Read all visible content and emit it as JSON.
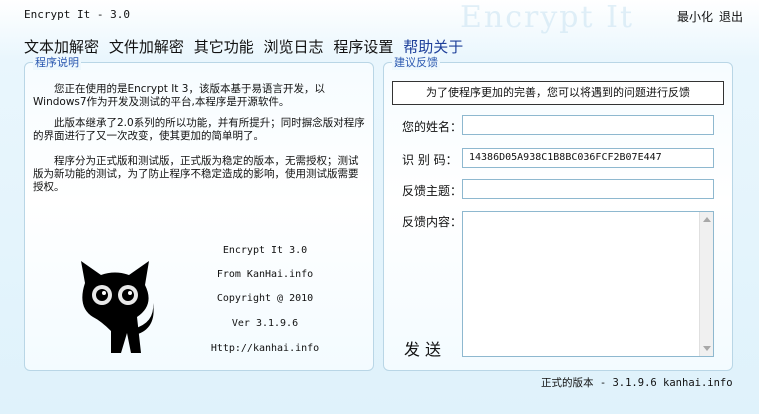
{
  "window": {
    "title": "Encrypt It - 3.0",
    "watermark": "Encrypt It",
    "minimize_label": "最小化",
    "exit_label": "退出"
  },
  "menu": {
    "items": [
      {
        "label": "文本加解密"
      },
      {
        "label": "文件加解密"
      },
      {
        "label": "其它功能"
      },
      {
        "label": "浏览日志"
      },
      {
        "label": "程序设置"
      },
      {
        "label": "帮助关于"
      }
    ],
    "active_color": "#1e3f9a"
  },
  "about": {
    "legend": "程序说明",
    "paragraphs": [
      "您正在使用的是Encrypt It 3，该版本基于易语言开发，以Windows7作为开发及测试的平台,本程序是开源软件。",
      "此版本继承了2.0系列的所以功能，并有所提升；同时摒念版对程序的界面进行了又一次改变，使其更加的简单明了。",
      "程序分为正式版和测试版，正式版为稳定的版本，无需授权；测试版为新功能的测试，为了防止程序不稳定造成的影响，使用测试版需要授权。"
    ],
    "info": [
      "Encrypt It 3.0",
      "From KanHai.info",
      "Copyright @ 2010",
      "Ver 3.1.9.6",
      "Http://kanhai.info"
    ],
    "mascot_icon": "black-cat-icon"
  },
  "feedback": {
    "legend": "建议反馈",
    "notice": "为了使程序更加的完善，您可以将遇到的问题进行反馈",
    "name_label": "您的姓名：",
    "name_value": "",
    "id_label": "识 别 码：",
    "id_value": "14386D05A938C1B8BC036FCF2B07E447",
    "subject_label": "反馈主题：",
    "subject_value": "",
    "content_label": "反馈内容：",
    "content_value": "",
    "send_label": "发送"
  },
  "footer": {
    "version_text": "正式的版本 - 3.1.9.6 kanhai.info"
  },
  "colors": {
    "accent": "#2a58b0",
    "panel_border": "#b9d6e6"
  }
}
